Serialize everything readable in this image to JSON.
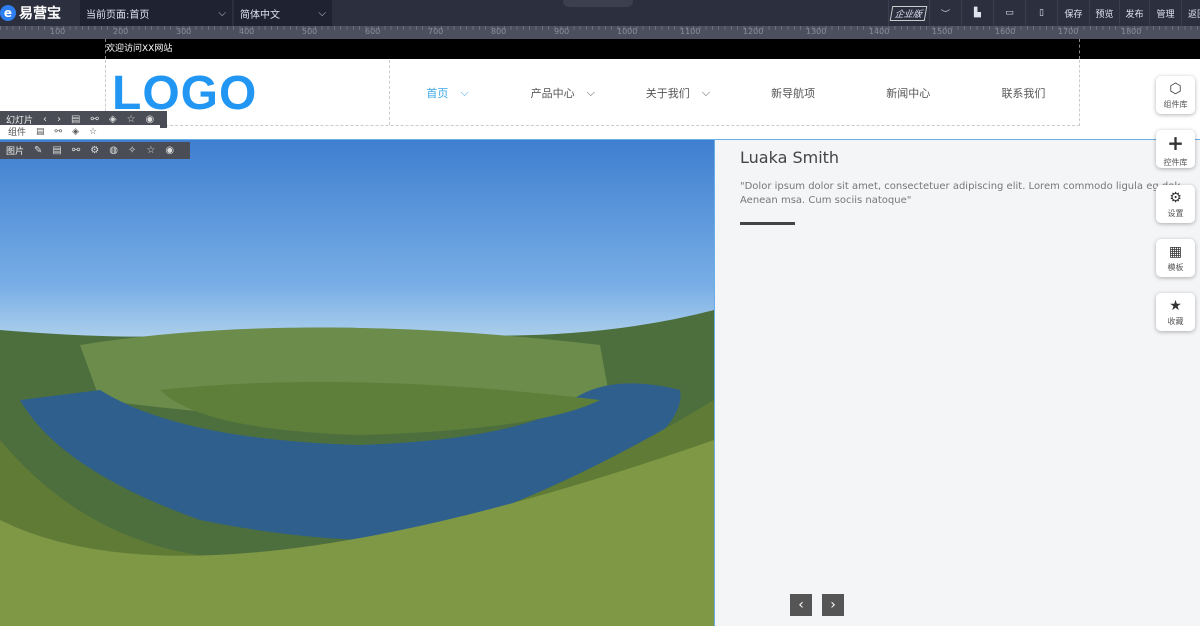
{
  "topbar": {
    "brand": "易营宝",
    "page_select": "当前页面:首页",
    "lang_select": "简体中文",
    "edition": "企业版",
    "buttons": [
      "保存",
      "预览",
      "发布",
      "管理",
      "返回"
    ]
  },
  "ruler": [
    "100",
    "200",
    "300",
    "400",
    "500",
    "600",
    "700",
    "800",
    "900",
    "1000",
    "1100",
    "1200",
    "1300",
    "1400",
    "1500",
    "1600",
    "1700",
    "1800"
  ],
  "welcome": "欢迎访问XX网站",
  "header": {
    "logo": "LOGO",
    "nav": [
      {
        "label": "首页",
        "dropdown": true,
        "active": true
      },
      {
        "label": "产品中心",
        "dropdown": true
      },
      {
        "label": "关于我们",
        "dropdown": true
      },
      {
        "label": "新导航项"
      },
      {
        "label": "新闻中心"
      },
      {
        "label": "联系我们"
      }
    ]
  },
  "toolbars": {
    "slideshow": "幻灯片",
    "group": "组件",
    "image": "图片"
  },
  "slide": {
    "name": "Luaka Smith",
    "quote": "\"Dolor ipsum dolor sit amet, consectetuer adipiscing elit. Lorem commodo ligula eg dolor. Lorem",
    "quote2": "Aenean msa. Cum sociis natoque\""
  },
  "side": [
    "组件库",
    "控件库",
    "设置",
    "模板",
    "收藏"
  ],
  "colors": {
    "accent": "#2196f3",
    "topbar": "#2b2f3e"
  }
}
